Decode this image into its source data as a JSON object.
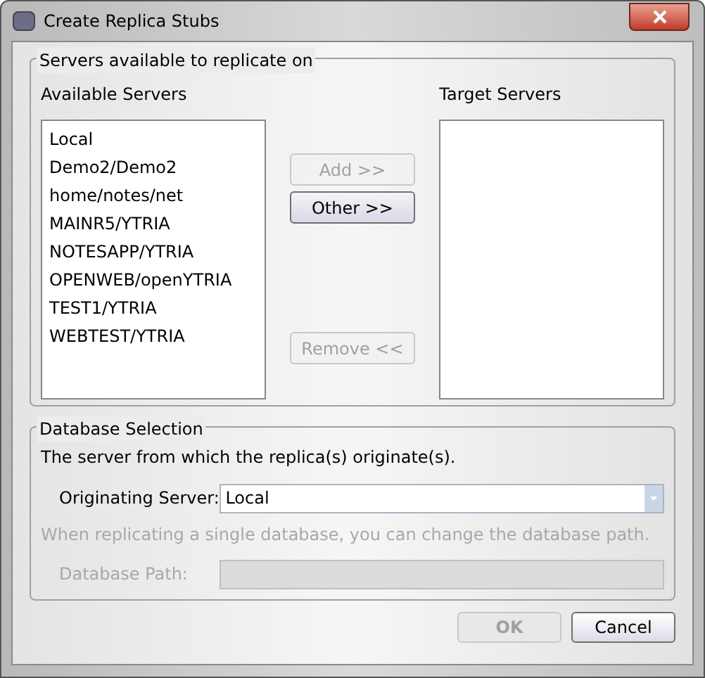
{
  "window": {
    "title": "Create Replica Stubs"
  },
  "servers_group": {
    "legend": "Servers available to replicate on",
    "available": {
      "label": "Available Servers",
      "items": [
        {
          "text": "Local"
        },
        {
          "text": "Demo2/Demo2"
        },
        {
          "text": "home/notes/net"
        },
        {
          "text": "MAINR5/YTRIA"
        },
        {
          "text": "NOTESAPP/YTRIA"
        },
        {
          "text": "OPENWEB/openYTRIA"
        },
        {
          "text": "TEST1/YTRIA"
        },
        {
          "text": "WEBTEST/YTRIA"
        }
      ]
    },
    "buttons": [
      {
        "label": "Add >>",
        "disabled": true
      },
      {
        "label": "Other >>",
        "disabled": false
      },
      {
        "label": "Remove <<",
        "disabled": true
      }
    ],
    "target": {
      "label": "Target Servers"
    }
  },
  "database_group": {
    "legend": "Database Selection",
    "description": "The server from which the replica(s) originate(s).",
    "originating": {
      "label": "Originating Server:",
      "value": "Local"
    },
    "hint": {
      "text": "When replicating a single database, you can change the database path.",
      "disabled": true
    },
    "path": {
      "label": "Database Path:",
      "disabled": true
    }
  },
  "dialog_buttons": [
    {
      "label": "OK",
      "disabled": true
    },
    {
      "label": "Cancel",
      "disabled": false
    }
  ]
}
